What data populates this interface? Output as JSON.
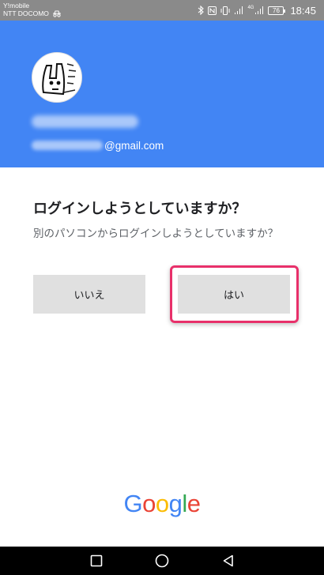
{
  "status_bar": {
    "carrier_1": "Y!mobile",
    "carrier_2": "NTT DOCOMO",
    "battery": "76",
    "time": "18:45",
    "signal_label": "4G"
  },
  "account": {
    "email_domain": "@gmail.com"
  },
  "prompt": {
    "title": "ログインしようとしていますか？",
    "subtitle": "別のパソコンからログインしようとしていますか？"
  },
  "buttons": {
    "no_label": "いいえ",
    "yes_label": "はい"
  },
  "highlight_color": "#e8306a",
  "header_color": "#4285f4",
  "logo": {
    "letters": [
      "G",
      "o",
      "o",
      "g",
      "l",
      "e"
    ],
    "colors": [
      "#4285f4",
      "#ea4335",
      "#fbbc05",
      "#4285f4",
      "#34a853",
      "#ea4335"
    ]
  },
  "nav": {
    "icons": [
      "recent-apps-icon",
      "home-icon",
      "back-icon"
    ]
  }
}
